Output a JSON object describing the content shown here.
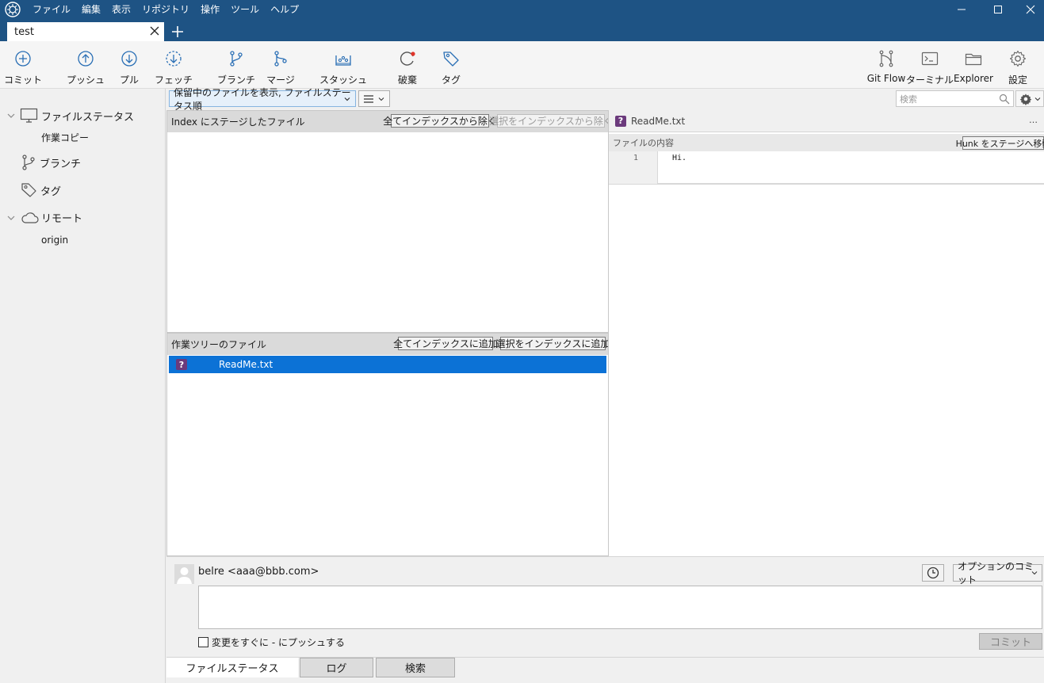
{
  "menu": [
    "ファイル",
    "編集",
    "表示",
    "リポジトリ",
    "操作",
    "ツール",
    "ヘルプ"
  ],
  "tab": {
    "title": "test"
  },
  "toolbar": {
    "commit": "コミット",
    "push": "プッシュ",
    "pull": "プル",
    "fetch": "フェッチ",
    "branch": "ブランチ",
    "merge": "マージ",
    "stash": "スタッシュ",
    "discard": "破棄",
    "tag": "タグ",
    "gitflow": "Git Flow",
    "terminal": "ターミナル",
    "explorer": "Explorer",
    "settings": "設定"
  },
  "sidebar": {
    "file_status": "ファイルステータス",
    "working_copy": "作業コピー",
    "branches": "ブランチ",
    "tags": "タグ",
    "remotes": "リモート",
    "origin": "origin"
  },
  "filter": {
    "selected": "保留中のファイルを表示, ファイルステータス順",
    "search_placeholder": "検索"
  },
  "staged": {
    "title": "Index にステージしたファイル",
    "unstage_all": "全てインデックスから除く",
    "unstage_selected": "選択をインデックスから除く"
  },
  "working": {
    "title": "作業ツリーのファイル",
    "stage_all": "全てインデックスに追加",
    "stage_selected": "選択をインデックスに追加",
    "files": [
      {
        "name": "ReadMe.txt",
        "status": "?"
      }
    ]
  },
  "diff": {
    "file": "ReadMe.txt",
    "more": "…",
    "subtitle": "ファイルの内容",
    "stage_hunk": "Hunk をステージへ移動",
    "line_no": "1",
    "line_text": "Hi."
  },
  "commit": {
    "author": "belre <aaa@bbb.com>",
    "options": "オプションのコミット",
    "push_now": "変更をすぐに - にプッシュする",
    "commit_button": "コミット"
  },
  "bottom_tabs": [
    "ファイルステータス",
    "ログ",
    "検索"
  ]
}
